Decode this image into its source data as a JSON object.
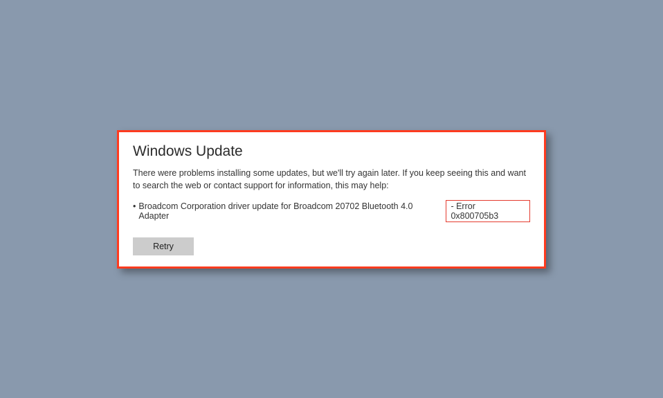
{
  "dialog": {
    "title": "Windows Update",
    "message": "There were problems installing some updates, but we'll try again later. If you keep seeing this and want to search the web or contact support for information, this may help:",
    "items": [
      {
        "bullet": "•",
        "description": "Broadcom Corporation driver update for Broadcom 20702 Bluetooth 4.0 Adapter",
        "error_sep": " - ",
        "error_code": "Error 0x800705b3"
      }
    ],
    "retry_label": "Retry"
  },
  "colors": {
    "background": "#8999ad",
    "panel_border": "#fe3b1f",
    "error_highlight_border": "#e43a2e",
    "button_bg": "#cccccc"
  }
}
